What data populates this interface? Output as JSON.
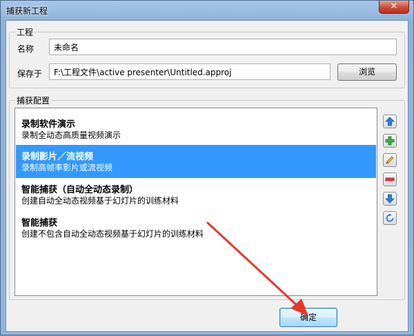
{
  "window": {
    "title": "捕获新工程",
    "close": "✕"
  },
  "project": {
    "group_label": "工程",
    "name_label": "名称",
    "name_value": "未命名",
    "save_label": "保存于",
    "save_value": "F:\\工程文件\\active presenter\\Untitled.approj",
    "browse_label": "浏览"
  },
  "capture": {
    "group_label": "捕获配置",
    "items": [
      {
        "title": "录制软件演示",
        "desc": "录制全动态高质量视频演示"
      },
      {
        "title": "录制影片／流视频",
        "desc": "录制高帧率影片或流视频"
      },
      {
        "title": "智能捕获（自动全动态录制）",
        "desc": "创建自动全动态视频基于幻灯片的训练材料"
      },
      {
        "title": "智能捕获",
        "desc": "创建不包含自动全动态视频基于幻灯片的训练材料"
      }
    ],
    "selected_index": 1,
    "side_icons": [
      "move-up-icon",
      "add-icon",
      "edit-icon",
      "remove-icon",
      "move-down-icon",
      "reset-icon"
    ]
  },
  "footer": {
    "ok_label": "确定"
  },
  "colors": {
    "selection": "#3399ff",
    "arrow": "#e8362a"
  }
}
